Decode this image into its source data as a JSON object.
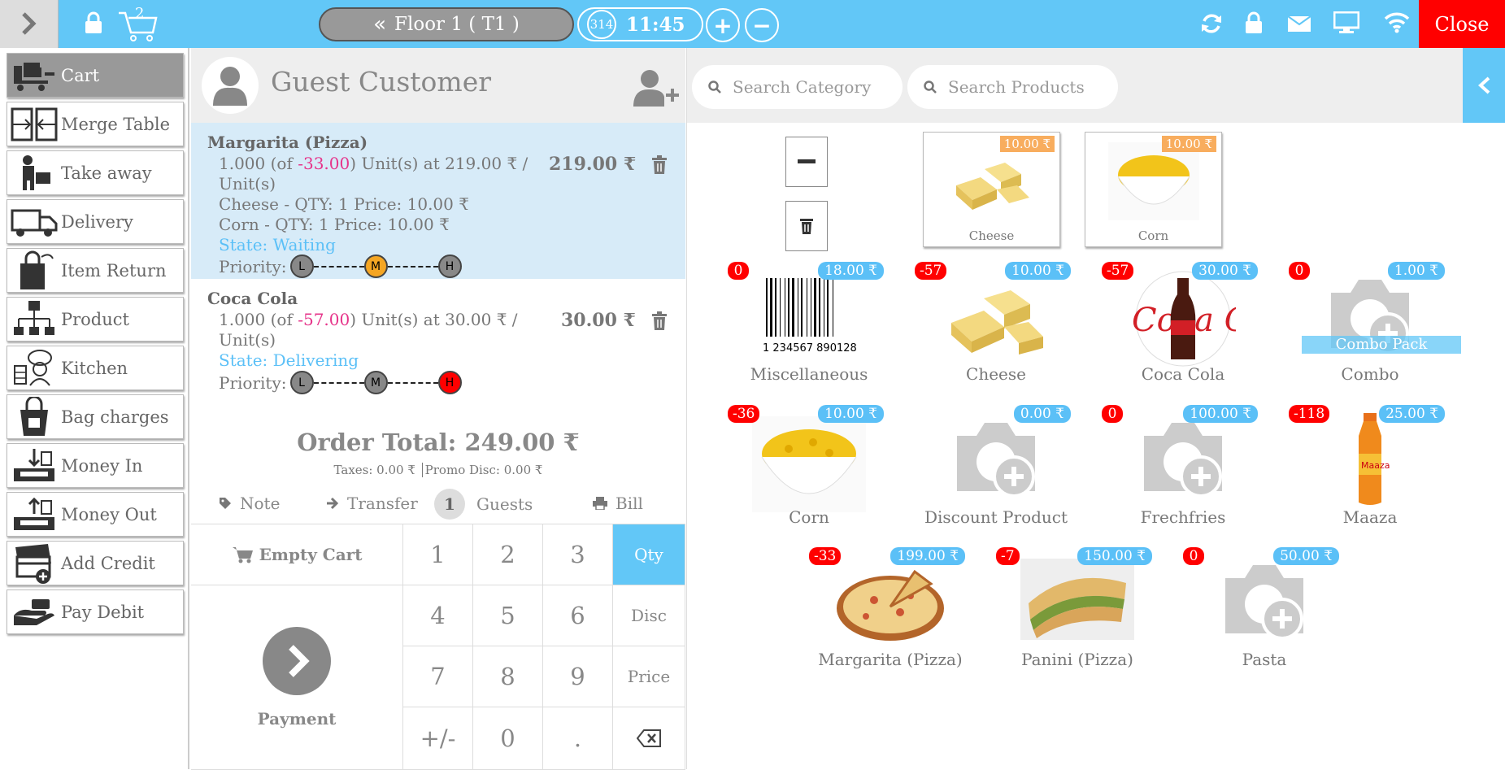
{
  "topbar": {
    "cart_count": "2",
    "floor_label": "Floor 1 ( T1 )",
    "order_counter": "314",
    "time": "11:45",
    "close_label": "Close"
  },
  "sidebar": {
    "items": [
      {
        "label": "Cart",
        "icon": "cart-trolley-icon"
      },
      {
        "label": "Merge Table",
        "icon": "merge-table-icon"
      },
      {
        "label": "Take away",
        "icon": "take-away-icon"
      },
      {
        "label": "Delivery",
        "icon": "delivery-truck-icon"
      },
      {
        "label": "Item Return",
        "icon": "item-return-bag-icon"
      },
      {
        "label": "Product",
        "icon": "product-hierarchy-icon"
      },
      {
        "label": "Kitchen",
        "icon": "kitchen-chef-icon"
      },
      {
        "label": "Bag charges",
        "icon": "bag-charges-icon"
      },
      {
        "label": "Money In",
        "icon": "money-in-icon"
      },
      {
        "label": "Money Out",
        "icon": "money-out-icon"
      },
      {
        "label": "Add Credit",
        "icon": "add-credit-icon"
      },
      {
        "label": "Pay Debit",
        "icon": "pay-debit-icon"
      }
    ]
  },
  "cart": {
    "customer": "Guest Customer",
    "lines": [
      {
        "name": "Margarita (Pizza)",
        "qty_prefix": "1.000 (of ",
        "qty_neg": "-33.00",
        "qty_suffix": ") Unit(s) at 219.00 ₹ /",
        "unit": "Unit(s)",
        "extra1": "Cheese - QTY: 1 Price: 10.00 ₹",
        "extra2": "Corn - QTY: 1 Price: 10.00 ₹",
        "state": "State: Waiting",
        "price": "219.00 ₹",
        "priority_label": "Priority:",
        "priority": "M"
      },
      {
        "name": "Coca Cola",
        "qty_prefix": "1.000 (of ",
        "qty_neg": "-57.00",
        "qty_suffix": ") Unit(s) at 30.00 ₹ /",
        "unit": "Unit(s)",
        "state": "State: Delivering",
        "price": "30.00 ₹",
        "priority_label": "Priority:",
        "priority": "H"
      }
    ],
    "priority_letters": [
      "L",
      "M",
      "H"
    ],
    "order_total": "Order Total: 249.00 ₹",
    "taxes": "Taxes: 0.00 ₹",
    "promo": "Promo Disc: 0.00 ₹",
    "actions": {
      "note": "Note",
      "transfer": "Transfer",
      "guests_count": "1",
      "guests": "Guests",
      "bill": "Bill"
    },
    "empty_cart": "Empty Cart",
    "payment": "Payment",
    "keys": [
      "1",
      "2",
      "3",
      "Qty",
      "4",
      "5",
      "6",
      "Disc",
      "7",
      "8",
      "9",
      "Price",
      "+/-",
      "0",
      "."
    ]
  },
  "products": {
    "search_category": "Search Category",
    "search_products": "Search Products",
    "combo_items": [
      {
        "name": "Cheese",
        "price": "10.00 ₹"
      },
      {
        "name": "Corn",
        "price": "10.00 ₹"
      }
    ],
    "items": [
      {
        "name": "Miscellaneous",
        "price": "18.00 ₹",
        "stock": "0",
        "img": "barcode"
      },
      {
        "name": "Cheese",
        "price": "10.00 ₹",
        "stock": "-57",
        "img": "cheese"
      },
      {
        "name": "Coca Cola",
        "price": "30.00 ₹",
        "stock": "-57",
        "img": "cola"
      },
      {
        "name": "Combo",
        "price": "1.00 ₹",
        "stock": "0",
        "img": "camera",
        "overlay": "Combo Pack"
      },
      {
        "name": "Corn",
        "price": "10.00 ₹",
        "stock": "-36",
        "img": "corn"
      },
      {
        "name": "Discount Product",
        "price": "0.00 ₹",
        "stock": "",
        "img": "camera"
      },
      {
        "name": "Frechfries",
        "price": "100.00 ₹",
        "stock": "0",
        "img": "camera"
      },
      {
        "name": "Maaza",
        "price": "25.00 ₹",
        "stock": "-118",
        "img": "maaza"
      },
      {
        "name": "Margarita (Pizza)",
        "price": "199.00 ₹",
        "stock": "-33",
        "img": "pizza"
      },
      {
        "name": "Panini (Pizza)",
        "price": "150.00 ₹",
        "stock": "-7",
        "img": "panini"
      },
      {
        "name": "Pasta",
        "price": "50.00 ₹",
        "stock": "0",
        "img": "camera"
      }
    ],
    "barcode_text": "1 234567 890128 >"
  },
  "colors": {
    "accent": "#62c7f7",
    "danger": "#ff0000",
    "priority_m": "#f5a623",
    "priority_h": "#ff0000"
  }
}
